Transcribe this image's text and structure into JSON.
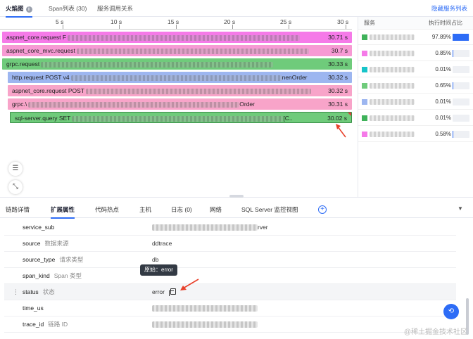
{
  "top_tabs": {
    "flame": "火焰图",
    "span_list": "Span列表 (30)",
    "call_graph": "服务调用关系",
    "hide_service_list": "隐藏服务列表"
  },
  "timeline": {
    "ticks": [
      "5 s",
      "10 s",
      "15 s",
      "20 s",
      "25 s",
      "30 s"
    ]
  },
  "spans": [
    {
      "label": "aspnet_core.request F",
      "duration": "30.71 s",
      "suffix": ""
    },
    {
      "label": "aspnet_core_mvc.request",
      "duration": "30.7 s",
      "suffix": ""
    },
    {
      "label": "grpc.request",
      "duration": "30.33 s",
      "suffix": ""
    },
    {
      "label": "http.request POST v4",
      "duration": "30.32 s",
      "suffix": "nenOrder"
    },
    {
      "label": "aspnet_core.request POST",
      "duration": "30.32 s",
      "suffix": ""
    },
    {
      "label": "grpc.\\",
      "duration": "30.31 s",
      "suffix": "Order"
    },
    {
      "label": "sql-server.query SET",
      "duration": "30.02 s",
      "suffix": "[C.."
    }
  ],
  "services_panel": {
    "header_service": "服务",
    "header_ratio": "执行时间占比",
    "rows": [
      {
        "color": "#3fb25a",
        "percent": "97.89%",
        "fill": 0.9789
      },
      {
        "color": "#f57ae8",
        "percent": "0.85%",
        "fill": 0.0085
      },
      {
        "color": "#17c4c9",
        "percent": "0.01%",
        "fill": 0.0001
      },
      {
        "color": "#6fcb7b",
        "percent": "0.65%",
        "fill": 0.0065
      },
      {
        "color": "#9db6f0",
        "percent": "0.01%",
        "fill": 0.0001
      },
      {
        "color": "#3fb25a",
        "percent": "0.01%",
        "fill": 0.0001
      },
      {
        "color": "#f57ae8",
        "percent": "0.58%",
        "fill": 0.0058
      }
    ]
  },
  "detail_tabs": {
    "trace_detail": "链路详情",
    "ext_attrs": "扩展属性",
    "code_hotspot": "代码热点",
    "host": "主机",
    "logs": "日志 (0)",
    "network": "网络",
    "sql_monitor": "SQL Server 监控视图"
  },
  "attributes": [
    {
      "key": "service_sub",
      "desc": "",
      "value": "rver"
    },
    {
      "key": "source",
      "desc": "数据来源",
      "value": "ddtrace"
    },
    {
      "key": "source_type",
      "desc": "请求类型",
      "value": "db"
    },
    {
      "key": "span_kind",
      "desc": "Span 类型",
      "value": ""
    },
    {
      "key": "status",
      "desc": "状态",
      "value": "error"
    },
    {
      "key": "time_us",
      "desc": "",
      "value": ""
    },
    {
      "key": "trace_id",
      "desc": "链路 ID",
      "value": ""
    }
  ],
  "tooltip": {
    "text": "原始：error"
  },
  "watermark": "@稀土掘金技术社区",
  "colors": {
    "accent": "#2d6cf6"
  }
}
